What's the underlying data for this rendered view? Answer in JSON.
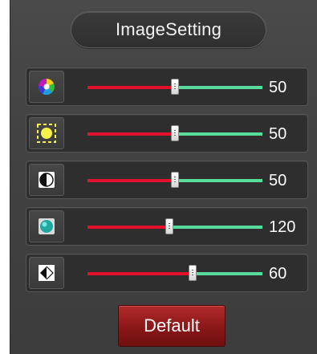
{
  "panel": {
    "title": "ImageSetting"
  },
  "sliders": [
    {
      "name": "color",
      "icon": "color-wheel-icon",
      "value": "50",
      "fraction": 0.5
    },
    {
      "name": "brightness",
      "icon": "sun-icon",
      "value": "50",
      "fraction": 0.5
    },
    {
      "name": "contrast",
      "icon": "contrast-icon",
      "value": "50",
      "fraction": 0.5
    },
    {
      "name": "saturation",
      "icon": "saturation-icon",
      "value": "120",
      "fraction": 0.47
    },
    {
      "name": "sharpness",
      "icon": "sharpness-icon",
      "value": "60",
      "fraction": 0.6
    }
  ],
  "footer": {
    "default_label": "Default"
  },
  "colors": {
    "track_left": "#e3112b",
    "track_right": "#57dc9b",
    "button": "#861616"
  }
}
